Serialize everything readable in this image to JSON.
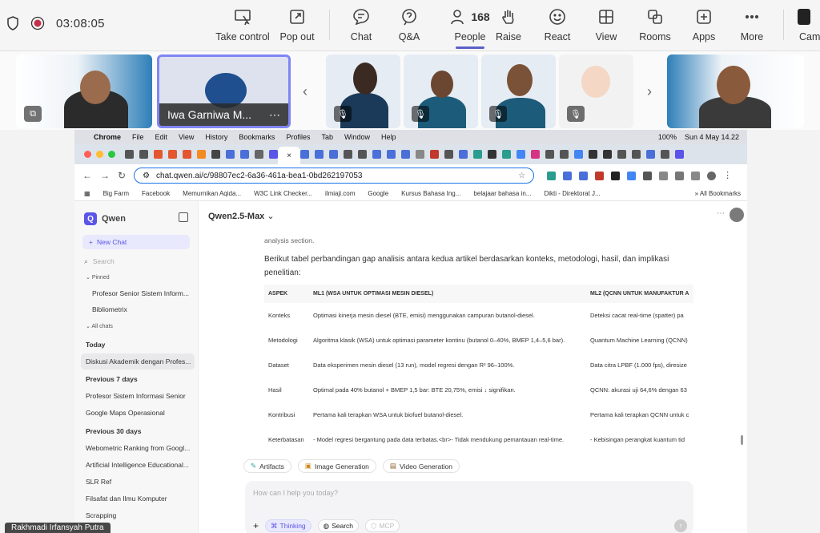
{
  "teams": {
    "timer": "03:08:05",
    "toolbar": [
      {
        "label": "Take control",
        "icon": "take-control-icon"
      },
      {
        "label": "Pop out",
        "icon": "pop-out-icon"
      },
      {
        "label": "Chat",
        "icon": "chat-icon"
      },
      {
        "label": "Q&A",
        "icon": "qa-icon"
      },
      {
        "label": "People",
        "icon": "people-icon"
      },
      {
        "label": "Raise",
        "icon": "raise-hand-icon"
      },
      {
        "label": "React",
        "icon": "react-icon"
      },
      {
        "label": "View",
        "icon": "view-icon"
      },
      {
        "label": "Rooms",
        "icon": "rooms-icon"
      },
      {
        "label": "Apps",
        "icon": "apps-icon"
      },
      {
        "label": "More",
        "icon": "more-icon"
      },
      {
        "label": "Came",
        "icon": "camera-icon"
      }
    ],
    "people_count": "168",
    "active_tab": "People",
    "pinned_participant": "Iwa Garniwa M...",
    "presenter": "Rakhmadi Irfansyah Putra"
  },
  "mac_menu": {
    "app": "Chrome",
    "items": [
      "File",
      "Edit",
      "View",
      "History",
      "Bookmarks",
      "Profiles",
      "Tab",
      "Window",
      "Help"
    ],
    "battery": "100%",
    "datetime": "Sun 4 May 14.22"
  },
  "browser": {
    "url": "chat.qwen.ai/c/98807ec2-6a36-461a-bea1-0bd262197053",
    "bookmarks": [
      "Big Farm",
      "Facebook",
      "Memurnikan Aqida...",
      "W3C Link Checker...",
      "ilmiaji.com",
      "Google",
      "Kursus Bahasa Ing...",
      "belajaar bahasa in...",
      "Dikti - Direktorat J..."
    ],
    "all_bookmarks": "All Bookmarks"
  },
  "qwen": {
    "logo": "Qwen",
    "new_chat": "New Chat",
    "search_placeholder": "Search",
    "pinned_label": "Pinned",
    "pinned": [
      "Profesor Senior Sistem Inform...",
      "Bibliometrix"
    ],
    "all_chats": "All chats",
    "sections": [
      {
        "title": "Today",
        "items": [
          "Diskusi Akademik dengan Profes..."
        ]
      },
      {
        "title": "Previous 7 days",
        "items": [
          "Profesor Sistem Informasi Senior",
          "Google Maps Operasional"
        ]
      },
      {
        "title": "Previous 30 days",
        "items": [
          "Webometric Ranking from Googl...",
          "Artificial Intelligence Educational...",
          "SLR Ref",
          "Filsafat dan Ilmu Komputer",
          "Scrapping"
        ]
      }
    ],
    "model": "Qwen2.5-Max",
    "prev_text": "analysis section.",
    "intro": "Berikut tabel perbandingan gap analisis antara kedua artikel berdasarkan konteks, metodologi, hasil, dan implikasi",
    "intro2": "penelitian:",
    "table": {
      "headers": [
        "ASPEK",
        "ML1 (WSA UNTUK OPTIMASI MESIN DIESEL)",
        "ML2 (QCNN UNTUK MANUFAKTUR A"
      ],
      "rows": [
        [
          "Konteks",
          "Optimasi kinerja mesin diesel (BTE, emisi) menggunakan campuran butanol-diesel.",
          "Deteksi cacat real-time (spatter) pa"
        ],
        [
          "Metodologi",
          "Algoritma klasik (WSA) untuk optimasi parameter kontinu (butanol 0–40%, BMEP 1,4–5,6 bar).",
          "Quantum Machine Learning (QCNN)"
        ],
        [
          "Dataset",
          "Data eksperimen mesin diesel (13 run), model regresi dengan R² 96–100%.",
          "Data citra LPBF (1.000 fps), diresize"
        ],
        [
          "Hasil",
          "Optimal pada 40% butanol + BMEP 1,5 bar: BTE 20,75%, emisi ↓ signifikan.",
          "QCNN: akurasi uji 64,6% dengan 63"
        ],
        [
          "Kontribusi",
          "Pertama kali terapkan WSA untuk biofuel butanol-diesel.",
          "Pertama kali terapkan QCNN untuk c"
        ],
        [
          "Keterbatasan",
          "- Model regresi bergantung pada data terbatas.<br>- Tidak mendukung pemantauan real-time.",
          "- Kebisingan perangkat kuantum tid"
        ]
      ]
    },
    "chips": [
      "Artifacts",
      "Image Generation",
      "Video Generation"
    ],
    "composer_placeholder": "How can I help you today?",
    "composer_buttons": [
      "Thinking",
      "Search",
      "MCP"
    ]
  }
}
